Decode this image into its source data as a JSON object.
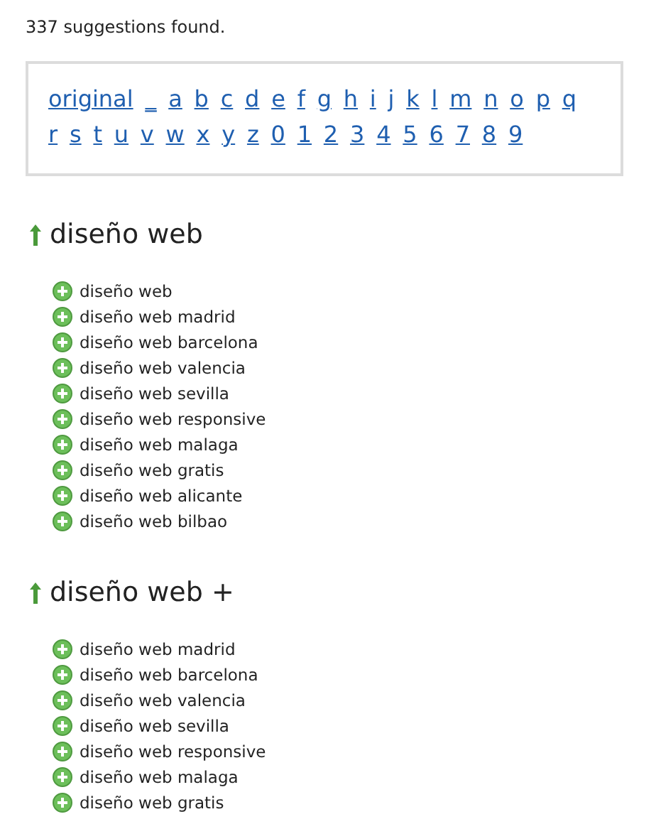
{
  "summary": "337 suggestions found.",
  "index_links": [
    "original",
    "_",
    "a",
    "b",
    "c",
    "d",
    "e",
    "f",
    "g",
    "h",
    "i",
    "j",
    "k",
    "l",
    "m",
    "n",
    "o",
    "p",
    "q",
    "r",
    "s",
    "t",
    "u",
    "v",
    "w",
    "x",
    "y",
    "z",
    "0",
    "1",
    "2",
    "3",
    "4",
    "5",
    "6",
    "7",
    "8",
    "9"
  ],
  "sections": [
    {
      "title": "diseño web",
      "items": [
        "diseño web",
        "diseño web madrid",
        "diseño web barcelona",
        "diseño web valencia",
        "diseño web sevilla",
        "diseño web responsive",
        "diseño web malaga",
        "diseño web gratis",
        "diseño web alicante",
        "diseño web bilbao"
      ]
    },
    {
      "title": "diseño web +",
      "items": [
        "diseño web madrid",
        "diseño web barcelona",
        "diseño web valencia",
        "diseño web sevilla",
        "diseño web responsive",
        "diseño web malaga",
        "diseño web gratis"
      ]
    }
  ]
}
